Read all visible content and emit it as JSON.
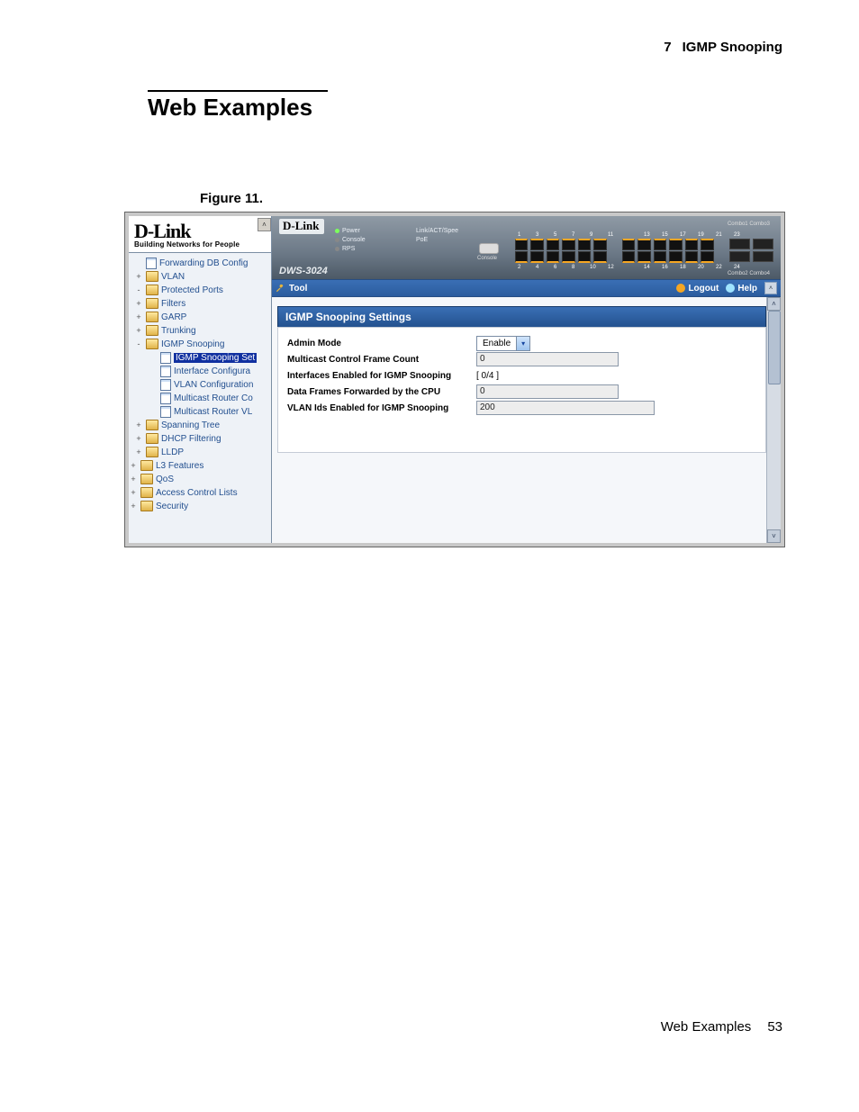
{
  "header": {
    "chapter_number": "7",
    "chapter_title": "IGMP Snooping"
  },
  "section_title": "Web Examples",
  "figure_caption": "Figure 11.",
  "footer": {
    "label": "Web Examples",
    "page_number": "53"
  },
  "sidebar": {
    "brand": "D-Link",
    "tagline": "Building Networks for People",
    "items": [
      {
        "icon": "page",
        "indent": 0,
        "label": "Forwarding DB Config",
        "exp": "",
        "sel": false
      },
      {
        "icon": "folder",
        "indent": 0,
        "label": "VLAN",
        "exp": "+",
        "sel": false
      },
      {
        "icon": "folder",
        "indent": 0,
        "label": "Protected Ports",
        "exp": "-",
        "sel": false
      },
      {
        "icon": "folder",
        "indent": 0,
        "label": "Filters",
        "exp": "+",
        "sel": false
      },
      {
        "icon": "folder",
        "indent": 0,
        "label": "GARP",
        "exp": "+",
        "sel": false
      },
      {
        "icon": "folder",
        "indent": 0,
        "label": "Trunking",
        "exp": "+",
        "sel": false
      },
      {
        "icon": "folder",
        "indent": 0,
        "label": "IGMP Snooping",
        "exp": "-",
        "sel": false
      },
      {
        "icon": "page",
        "indent": 1,
        "label": "IGMP Snooping Set",
        "exp": "",
        "sel": true
      },
      {
        "icon": "page",
        "indent": 1,
        "label": "Interface Configura",
        "exp": "",
        "sel": false
      },
      {
        "icon": "page",
        "indent": 1,
        "label": "VLAN Configuration",
        "exp": "",
        "sel": false
      },
      {
        "icon": "page",
        "indent": 1,
        "label": "Multicast Router Co",
        "exp": "",
        "sel": false
      },
      {
        "icon": "page",
        "indent": 1,
        "label": "Multicast Router VL",
        "exp": "",
        "sel": false
      },
      {
        "icon": "folder",
        "indent": 0,
        "label": "Spanning Tree",
        "exp": "+",
        "sel": false
      },
      {
        "icon": "folder",
        "indent": 0,
        "label": "DHCP Filtering",
        "exp": "+",
        "sel": false
      },
      {
        "icon": "folder",
        "indent": 0,
        "label": "LLDP",
        "exp": "+",
        "sel": false
      },
      {
        "icon": "folder",
        "indent": -1,
        "label": "L3 Features",
        "exp": "+",
        "sel": false
      },
      {
        "icon": "folder",
        "indent": -1,
        "label": "QoS",
        "exp": "+",
        "sel": false
      },
      {
        "icon": "folder",
        "indent": -1,
        "label": "Access Control Lists",
        "exp": "+",
        "sel": false
      },
      {
        "icon": "folder",
        "indent": -1,
        "label": "Security",
        "exp": "+",
        "sel": false
      }
    ]
  },
  "device": {
    "brand": "D-Link",
    "model": "DWS-3024",
    "leds": [
      {
        "cls": "g",
        "label": "Power"
      },
      {
        "cls": "o",
        "label": "Console"
      },
      {
        "cls": "o",
        "label": "RPS"
      }
    ],
    "leds2": [
      {
        "cls": "g",
        "label": "Link/ACT/Spee"
      },
      {
        "cls": "o",
        "label": "PoE"
      }
    ],
    "console_label": "Console",
    "top_port_nums": [
      "1",
      "3",
      "5",
      "7",
      "9",
      "11",
      "",
      "13",
      "15",
      "17",
      "19",
      "21",
      "23"
    ],
    "bot_port_nums": [
      "2",
      "4",
      "6",
      "8",
      "10",
      "12",
      "",
      "14",
      "16",
      "18",
      "20",
      "22",
      "24"
    ],
    "combo_top": "Combo1 Combo3",
    "combo_bot": "Combo2 Combo4"
  },
  "toolbar": {
    "tool": "Tool",
    "logout": "Logout",
    "help": "Help"
  },
  "panel": {
    "title": "IGMP Snooping Settings",
    "rows": [
      {
        "label": "Admin Mode",
        "type": "select",
        "value": "Enable"
      },
      {
        "label": "Multicast Control Frame Count",
        "type": "read",
        "value": "0"
      },
      {
        "label": "Interfaces Enabled for IGMP Snooping",
        "type": "text",
        "value": "[ 0/4 ]"
      },
      {
        "label": "Data Frames Forwarded by the CPU",
        "type": "read",
        "value": "0"
      },
      {
        "label": "VLAN Ids Enabled for IGMP Snooping",
        "type": "readwide",
        "value": "200"
      }
    ]
  }
}
